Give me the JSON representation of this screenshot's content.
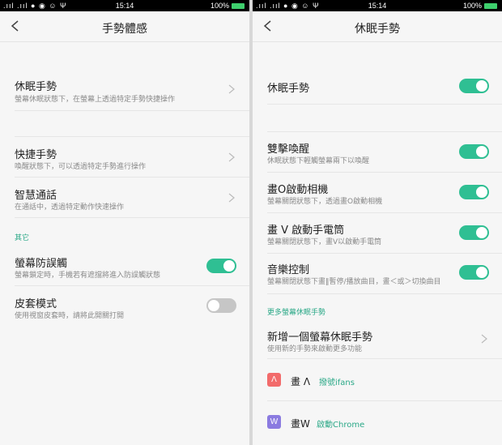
{
  "status": {
    "time": "15:14",
    "battery": "100%"
  },
  "left": {
    "title": "手勢體感",
    "items": [
      {
        "title": "休眠手勢",
        "subtitle": "螢幕休眠狀態下，在螢幕上透過特定手勢快捷操作"
      },
      {
        "title": "快捷手勢",
        "subtitle": "喚醒狀態下，可以透過特定手勢進行操作"
      },
      {
        "title": "智慧通話",
        "subtitle": "在通話中，透過特定動作快速操作"
      }
    ],
    "section_other": "其它",
    "toggles": [
      {
        "title": "螢幕防誤觸",
        "subtitle": "螢幕鎖定時，手機若有遮擋將進入防誤觸狀態",
        "on": true
      },
      {
        "title": "皮套模式",
        "subtitle": "使用視窗皮套時，請將此開關打開",
        "on": false
      }
    ]
  },
  "right": {
    "title": "休眠手勢",
    "master": {
      "title": "休眠手勢",
      "on": true
    },
    "gestures": [
      {
        "title": "雙擊喚醒",
        "subtitle": "休眠狀態下輕觸螢幕兩下以喚醒",
        "on": true
      },
      {
        "title": "畫O啟動相機",
        "subtitle": "螢幕關閉狀態下，透過畫O啟動相機",
        "on": true
      },
      {
        "title": "畫 V 啟動手電筒",
        "subtitle": "螢幕關閉狀態下，畫V以啟動手電筒",
        "on": true
      },
      {
        "title": "音樂控制",
        "subtitle": "螢幕關閉狀態下畫‖暫停/播放曲目，畫＜或＞切換曲目",
        "on": true
      }
    ],
    "section_more": "更多螢幕休眠手勢",
    "add": {
      "title": "新增一個螢幕休眠手勢",
      "subtitle": "使用新的手勢來啟動更多功能"
    },
    "custom": [
      {
        "icon_letter": "Λ",
        "icon_color": "#f26b6b",
        "name": "畫 Λ",
        "action": "撥號ifans"
      },
      {
        "icon_letter": "W",
        "icon_color": "#8b7be0",
        "name": "畫W",
        "action": "啟動Chrome"
      }
    ]
  }
}
